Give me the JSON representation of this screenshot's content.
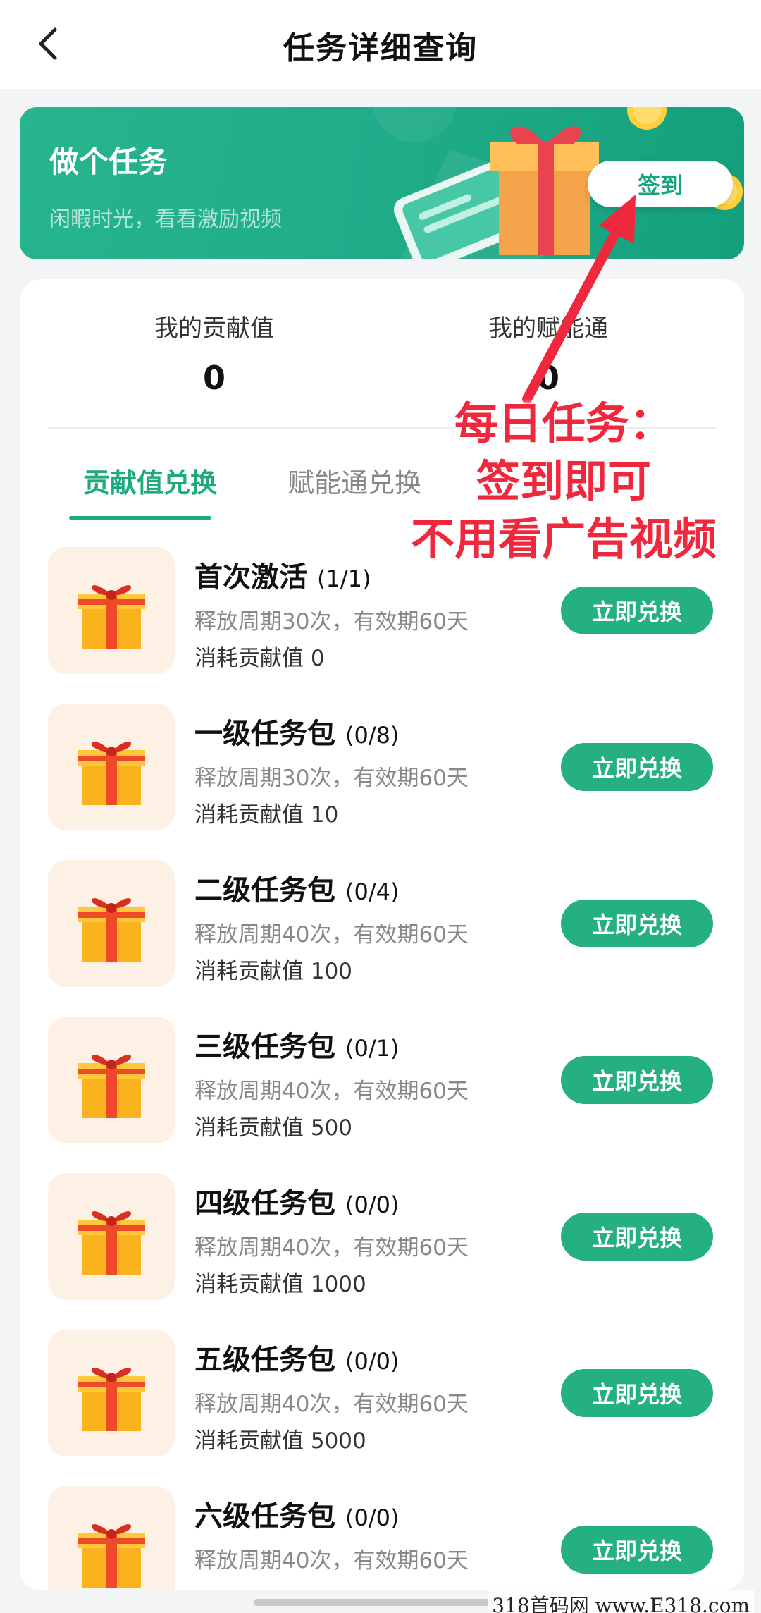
{
  "header": {
    "title": "任务详细查询",
    "back_icon": "chevron-left-icon"
  },
  "banner": {
    "title": "做个任务",
    "subtitle": "闲暇时光，看看激励视频",
    "signin_label": "签到",
    "accent_color": "#20ad8a"
  },
  "stats": [
    {
      "label": "我的贡献值",
      "value": "0"
    },
    {
      "label": "我的赋能通",
      "value": "0"
    }
  ],
  "tabs": [
    {
      "label": "贡献值兑换",
      "active": true
    },
    {
      "label": "赋能通兑换",
      "active": false
    }
  ],
  "tasks": [
    {
      "title": "首次激活",
      "count": "(1/1)",
      "desc": "释放周期30次，有效期60天",
      "cost": "消耗贡献值 0",
      "button": "立即兑换"
    },
    {
      "title": "一级任务包",
      "count": "(0/8)",
      "desc": "释放周期30次，有效期60天",
      "cost": "消耗贡献值 10",
      "button": "立即兑换"
    },
    {
      "title": "二级任务包",
      "count": "(0/4)",
      "desc": "释放周期40次，有效期60天",
      "cost": "消耗贡献值 100",
      "button": "立即兑换"
    },
    {
      "title": "三级任务包",
      "count": "(0/1)",
      "desc": "释放周期40次，有效期60天",
      "cost": "消耗贡献值 500",
      "button": "立即兑换"
    },
    {
      "title": "四级任务包",
      "count": "(0/0)",
      "desc": "释放周期40次，有效期60天",
      "cost": "消耗贡献值 1000",
      "button": "立即兑换"
    },
    {
      "title": "五级任务包",
      "count": "(0/0)",
      "desc": "释放周期40次，有效期60天",
      "cost": "消耗贡献值 5000",
      "button": "立即兑换"
    },
    {
      "title": "六级任务包",
      "count": "(0/0)",
      "desc": "释放周期40次，有效期60天",
      "cost": "",
      "button": "立即兑换"
    }
  ],
  "annotation": {
    "lines": [
      "每日任务：",
      "签到即可",
      "不用看广告视频"
    ],
    "color": "#f0283e"
  },
  "watermark": "318首码网 www.E318.com"
}
